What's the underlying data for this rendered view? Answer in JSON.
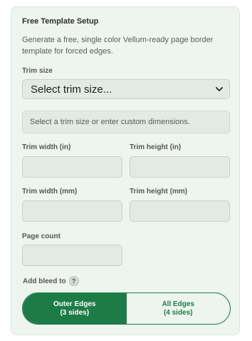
{
  "setup": {
    "title": "Free Template Setup",
    "description": "Generate a free, single color Vellum-ready page border template for forced edges."
  },
  "trim_size": {
    "label": "Trim size",
    "selected": "Select trim size...",
    "hint": "Select a trim size or enter custom dimensions."
  },
  "fields": {
    "trim_width_in": {
      "label": "Trim width (in)",
      "value": ""
    },
    "trim_height_in": {
      "label": "Trim height (in)",
      "value": ""
    },
    "trim_width_mm": {
      "label": "Trim width (mm)",
      "value": ""
    },
    "trim_height_mm": {
      "label": "Trim height (mm)",
      "value": ""
    },
    "page_count": {
      "label": "Page count",
      "value": ""
    }
  },
  "bleed": {
    "label": "Add bleed to",
    "help": "?",
    "options": [
      {
        "line1": "Outer Edges",
        "line2": "(3 sides)",
        "selected": true
      },
      {
        "line1": "All Edges",
        "line2": "(4 sides)",
        "selected": false
      }
    ]
  },
  "colors": {
    "accent": "#1d7c45",
    "panel_bg": "#eef4ee",
    "field_bg": "#e3e9e3"
  },
  "icons": {
    "select_arrow": "chevron-down-icon",
    "help": "question-circle-icon"
  }
}
